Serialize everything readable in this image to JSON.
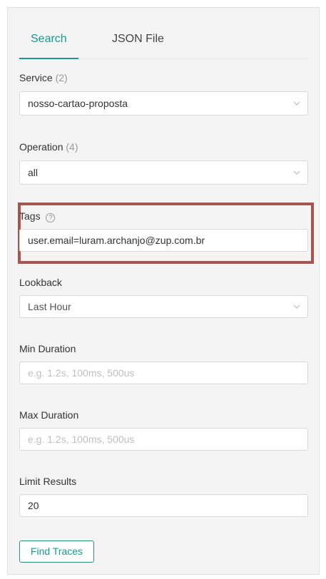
{
  "tabs": {
    "search": "Search",
    "json_file": "JSON File"
  },
  "service": {
    "label": "Service",
    "count": "(2)",
    "value": "nosso-cartao-proposta"
  },
  "operation": {
    "label": "Operation",
    "count": "(4)",
    "value": "all"
  },
  "tags": {
    "label": "Tags",
    "help": "?",
    "value": "user.email=luram.archanjo@zup.com.br"
  },
  "lookback": {
    "label": "Lookback",
    "value": "Last Hour"
  },
  "min_duration": {
    "label": "Min Duration",
    "placeholder": "e.g. 1.2s, 100ms, 500us"
  },
  "max_duration": {
    "label": "Max Duration",
    "placeholder": "e.g. 1.2s, 100ms, 500us"
  },
  "limit": {
    "label": "Limit Results",
    "value": "20"
  },
  "find_button": "Find Traces",
  "colors": {
    "accent": "#199a8d",
    "highlight_border": "#a9544f",
    "panel_bg": "#f4f4f4"
  }
}
